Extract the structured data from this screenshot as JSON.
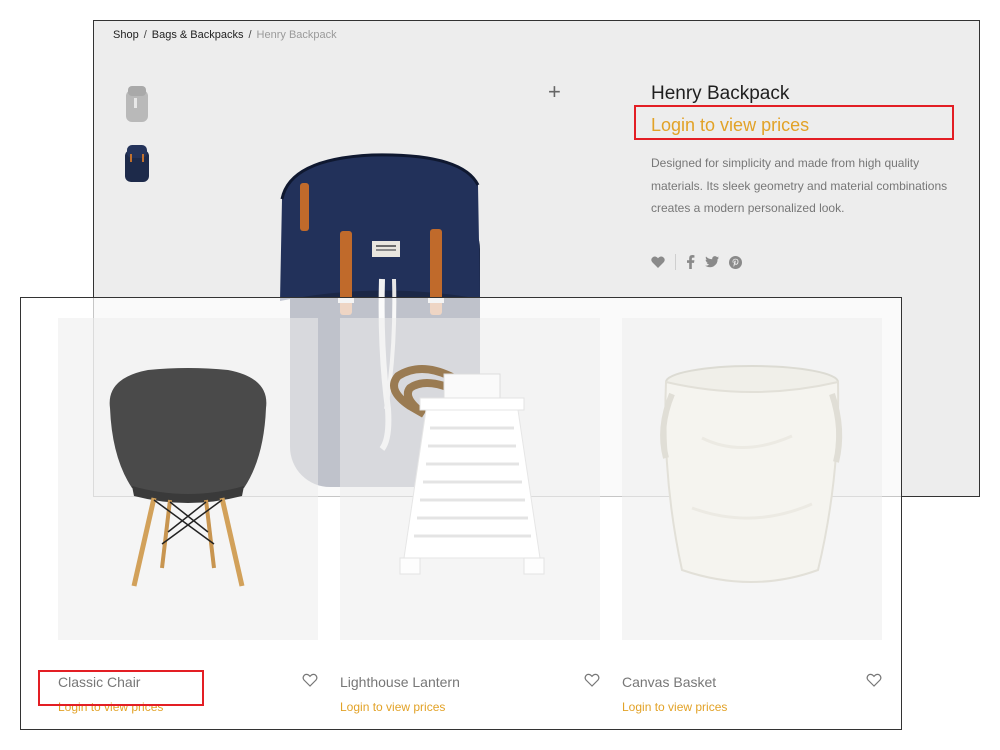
{
  "product_page": {
    "breadcrumb": [
      {
        "label": "Shop"
      },
      {
        "label": "Bags & Backpacks"
      },
      {
        "label": "Henry Backpack"
      }
    ],
    "breadcrumb_separator": "/",
    "zoom_icon": "plus-icon",
    "title": "Henry Backpack",
    "price_text": "Login to view prices",
    "description": "Designed for simplicity and made from high quality materials. Its sleek geometry and material combinations creates a modern personalized look.",
    "share_icons": [
      "heart-icon",
      "facebook-icon",
      "twitter-icon",
      "pinterest-icon"
    ]
  },
  "product_grid": {
    "products": [
      {
        "name": "Classic Chair",
        "price_text": "Login to view prices",
        "icon": "heart-outline-icon"
      },
      {
        "name": "Lighthouse Lantern",
        "price_text": "Login to view prices",
        "icon": "heart-outline-icon"
      },
      {
        "name": "Canvas Basket",
        "price_text": "Login to view prices",
        "icon": "heart-outline-icon"
      }
    ]
  },
  "colors": {
    "accent_price": "#e2a227",
    "highlight_box": "#e31e24",
    "panel_bg": "#ededed",
    "text_muted": "#777777"
  }
}
